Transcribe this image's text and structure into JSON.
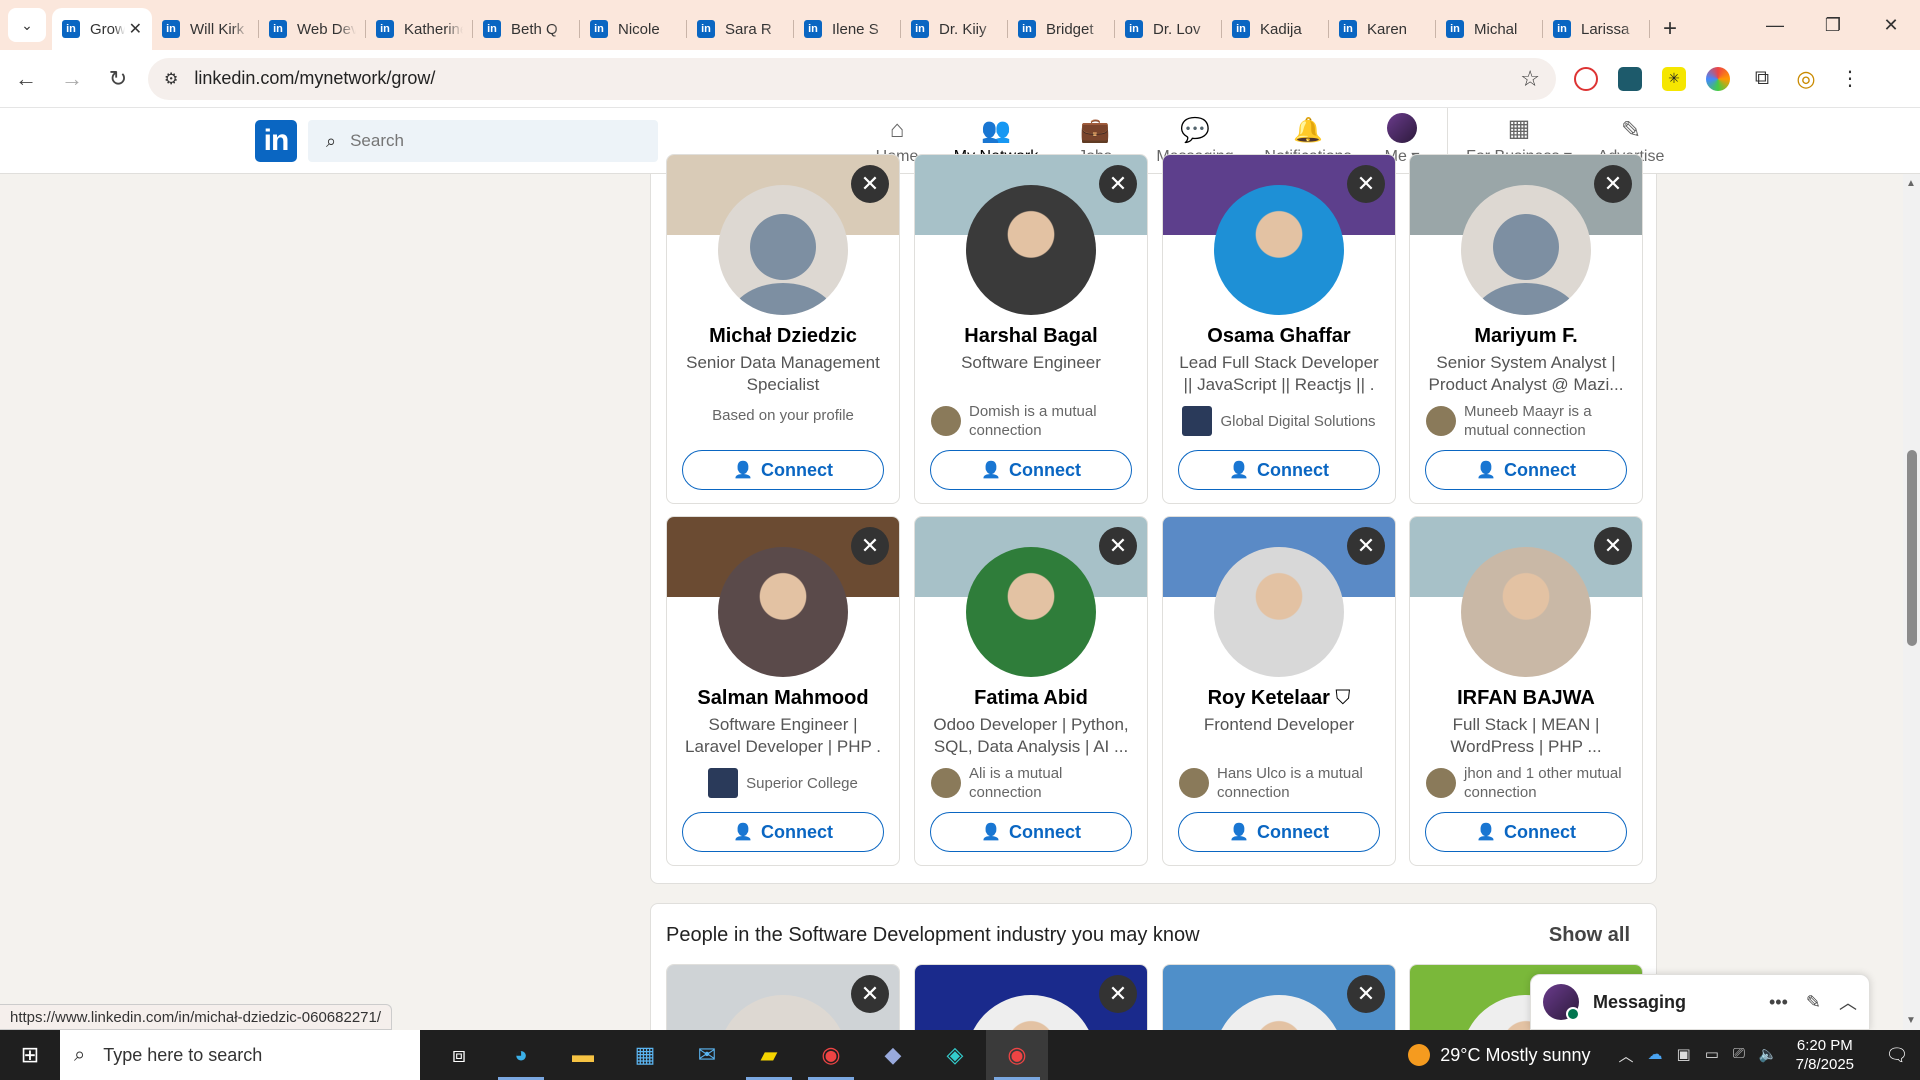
{
  "browser": {
    "tabs": [
      {
        "title": "Grow",
        "active": true
      },
      {
        "title": "Will Kirk"
      },
      {
        "title": "Web Dev"
      },
      {
        "title": "Katherine"
      },
      {
        "title": "Beth Q"
      },
      {
        "title": "Nicole"
      },
      {
        "title": "Sara R"
      },
      {
        "title": "Ilene S"
      },
      {
        "title": "Dr. Kiiy"
      },
      {
        "title": "Bridget"
      },
      {
        "title": "Dr. Lov"
      },
      {
        "title": "Kadija"
      },
      {
        "title": "Karen"
      },
      {
        "title": "Michal"
      },
      {
        "title": "Larissa"
      }
    ],
    "new_tab": "+",
    "url": "linkedin.com/mynetwork/grow/",
    "status_url": "https://www.linkedin.com/in/michał-dziedzic-060682271/"
  },
  "linkedin": {
    "logo": "in",
    "search_placeholder": "Search",
    "nav": [
      {
        "label": "Home",
        "icon": "home-icon",
        "glyph": "⌂"
      },
      {
        "label": "My Network",
        "icon": "network-icon",
        "glyph": "👥",
        "active": true
      },
      {
        "label": "Jobs",
        "icon": "briefcase-icon",
        "glyph": "💼"
      },
      {
        "label": "Messaging",
        "icon": "messaging-icon",
        "glyph": "💬"
      },
      {
        "label": "Notifications",
        "icon": "bell-icon",
        "glyph": "🔔"
      },
      {
        "label": "Me ▾",
        "icon": "avatar"
      }
    ],
    "nav_right": [
      {
        "label": "For Business ▾",
        "icon": "grid-icon",
        "glyph": "▦"
      },
      {
        "label": "Advertise",
        "icon": "compass-icon",
        "glyph": "✎"
      }
    ]
  },
  "people": [
    {
      "name": "Michał Dziedzic",
      "headline": "Senior Data Management Specialist",
      "meta": "Based on your profile",
      "meta_type": "text",
      "avatar": "default",
      "banner": "#d9cbb7"
    },
    {
      "name": "Harshal Bagal",
      "headline": "Software Engineer",
      "meta": "Domish is a mutual connection",
      "meta_type": "person",
      "avatar": "#3a3a3a",
      "banner": "#a7c1c8"
    },
    {
      "name": "Osama Ghaffar",
      "headline": "Lead Full Stack Developer || JavaScript || Reactjs || .",
      "meta": "Global Digital Solutions",
      "meta_type": "org",
      "avatar": "#1e90d6",
      "banner": "#5d3f8c"
    },
    {
      "name": "Mariyum F.",
      "headline": "Senior System Analyst | Product Analyst @ Mazi...",
      "meta": "Muneeb Maayr is a mutual connection",
      "meta_type": "person",
      "avatar": "default",
      "banner": "#9aa6a8"
    },
    {
      "name": "Salman Mahmood",
      "headline": "Software Engineer | Laravel Developer | PHP .",
      "meta": "Superior College",
      "meta_type": "org",
      "avatar": "#5a4a4a",
      "banner": "#6b4b32"
    },
    {
      "name": "Fatima Abid",
      "headline": "Odoo Developer | Python, SQL, Data Analysis | AI ...",
      "meta": "Ali is a mutual connection",
      "meta_type": "person",
      "avatar": "#2f7d3a",
      "banner": "#a7c1c8"
    },
    {
      "name": "Roy Ketelaar",
      "verified": true,
      "headline": "Frontend Developer",
      "meta": "Hans Ulco is a mutual connection",
      "meta_type": "person",
      "avatar": "#d8d8d8",
      "banner": "#5a8ac6"
    },
    {
      "name": "IRFAN BAJWA",
      "headline": "Full Stack | MEAN | WordPress | PHP ...",
      "meta": "jhon and 1 other mutual connection",
      "meta_type": "person",
      "avatar": "#c9b8a6",
      "banner": "#a7c1c8"
    }
  ],
  "connect_label": "Connect",
  "section2": {
    "title": "People in the Software Development industry you may know",
    "show_all": "Show all",
    "banners": [
      "#cfd3d6",
      "#1a2a8c",
      "#4f8fc9",
      "#7ab83a"
    ]
  },
  "messaging": {
    "label": "Messaging"
  },
  "taskbar": {
    "search_placeholder": "Type here to search",
    "weather": "29°C  Mostly sunny",
    "time": "6:20 PM",
    "date": "7/8/2025"
  }
}
